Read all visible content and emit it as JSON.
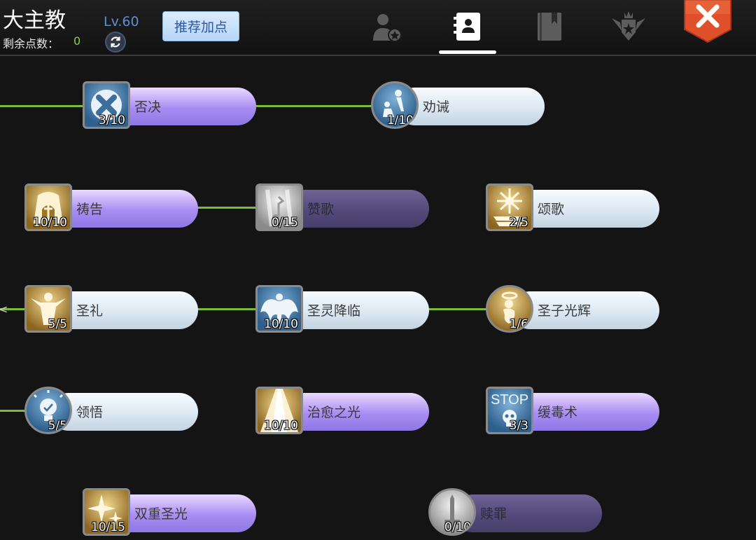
{
  "header": {
    "class_name": "大主教",
    "points_label": "剩余点数：",
    "points_value": "0",
    "level": "Lv.60",
    "recommend_label": "推荐加点",
    "tabs": [
      {
        "icon": "character-icon",
        "active": false
      },
      {
        "icon": "skill-book-icon",
        "active": true
      },
      {
        "icon": "journal-icon",
        "active": false
      },
      {
        "icon": "rank-emblem-icon",
        "active": false
      }
    ],
    "close_icon": "close-icon",
    "accent_color": "#7dbb3a",
    "close_color": "#e0502a"
  },
  "skills": [
    {
      "id": "veto",
      "name": "否决",
      "level": "3/10",
      "icon": "cross-icon",
      "pill": "purple"
    },
    {
      "id": "admonish",
      "name": "劝诫",
      "level": "1/10",
      "icon": "kneeling-figure-icon",
      "pill": "light"
    },
    {
      "id": "prayer",
      "name": "祷告",
      "level": "10/10",
      "icon": "arch-icon",
      "pill": "purple"
    },
    {
      "id": "hymn",
      "name": "赞歌",
      "level": "0/15",
      "icon": "music-note-icon",
      "pill": "locked"
    },
    {
      "id": "ode",
      "name": "颂歌",
      "level": "2/5",
      "icon": "radiant-book-icon",
      "pill": "light"
    },
    {
      "id": "sacrament",
      "name": "圣礼",
      "level": "5/5",
      "icon": "blessing-figure-icon",
      "pill": "light"
    },
    {
      "id": "holy_spirit",
      "name": "圣灵降临",
      "level": "10/10",
      "icon": "angel-wings-icon",
      "pill": "light"
    },
    {
      "id": "holy_child",
      "name": "圣子光辉",
      "level": "1/6",
      "icon": "halo-child-icon",
      "pill": "light"
    },
    {
      "id": "enlighten",
      "name": "领悟",
      "level": "5/5",
      "icon": "lightbulb-icon",
      "pill": "light"
    },
    {
      "id": "healing_light",
      "name": "治愈之光",
      "level": "10/10",
      "icon": "light-beam-icon",
      "pill": "purple"
    },
    {
      "id": "slow_poison",
      "name": "缓毒术",
      "level": "3/3",
      "icon": "stop-skull-icon",
      "pill": "purple"
    },
    {
      "id": "double_light",
      "name": "双重圣光",
      "level": "10/15",
      "icon": "sparkle-icon",
      "pill": "purple"
    },
    {
      "id": "atonement",
      "name": "赎罪",
      "level": "0/10",
      "icon": "sword-icon",
      "pill": "locked"
    }
  ]
}
